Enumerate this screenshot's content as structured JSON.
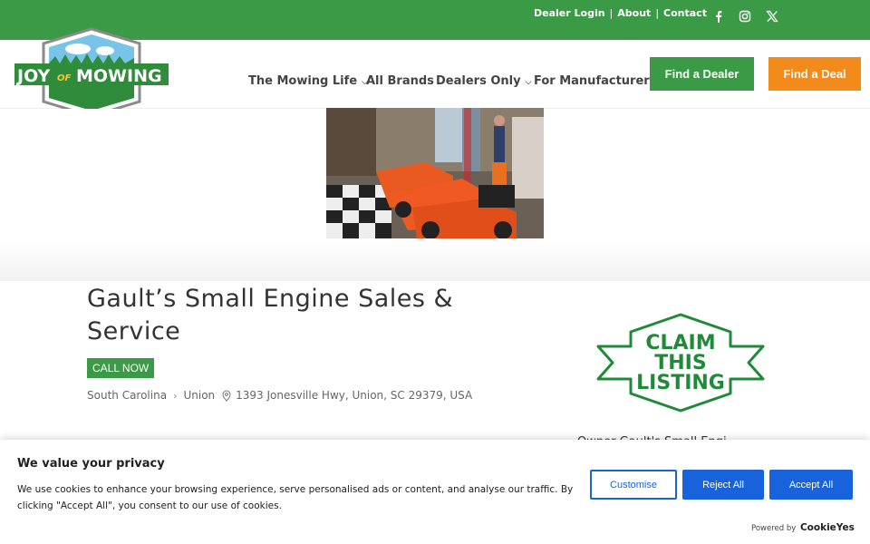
{
  "topbar": {
    "links": [
      "Dealer Login",
      "About",
      "Contact"
    ],
    "social_icons": [
      "facebook-icon",
      "instagram-icon",
      "x-icon"
    ]
  },
  "logo": {
    "text_joy": "JOY",
    "text_of": "OF",
    "text_mowing": "MOWING"
  },
  "nav": {
    "items": [
      {
        "label": "The Mowing Life",
        "dropdown": true
      },
      {
        "label": "All Brands",
        "dropdown": false
      },
      {
        "label": "Dealers Only",
        "dropdown": true
      },
      {
        "label": "For Manufacturers",
        "dropdown": false
      }
    ],
    "find_dealer": "Find a Dealer",
    "find_deal": "Find a Deal"
  },
  "listing": {
    "title": "Gault’s Small Engine Sales & Service",
    "call_now": "CALL NOW",
    "state": "South Carolina",
    "city": "Union",
    "address": "1393 Jonesville Hwy, Union, SC 29379, USA",
    "claim_line1": "CLAIM",
    "claim_line2": "THIS",
    "claim_line3": "LISTING",
    "partial_text": "Owner Gault's Small Engi"
  },
  "cookie": {
    "title": "We value your privacy",
    "text": "We use cookies to enhance your browsing experience, serve personalised ads or content, and analyse our traffic. By clicking \"Accept All\", you consent to our use of cookies.",
    "customise": "Customise",
    "reject": "Reject All",
    "accept": "Accept All",
    "powered_by": "Powered by",
    "brand": "CookieYes"
  },
  "colors": {
    "brand_green": "#3b9a45",
    "deal_orange": "#f28a1c",
    "cookie_blue": "#1863dc"
  }
}
